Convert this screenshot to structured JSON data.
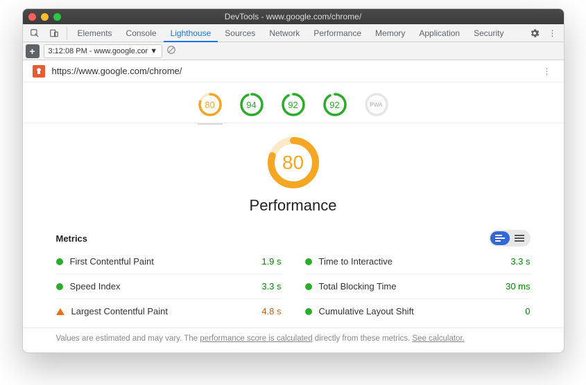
{
  "window": {
    "title": "DevTools - www.google.com/chrome/"
  },
  "tabs": [
    "Elements",
    "Console",
    "Lighthouse",
    "Sources",
    "Network",
    "Performance",
    "Memory",
    "Application",
    "Security"
  ],
  "active_tab": "Lighthouse",
  "toolbar": {
    "run_label": "3:12:08 PM - www.google.cor"
  },
  "url": "https://www.google.com/chrome/",
  "gauges": [
    {
      "score": "80",
      "color": "orange",
      "pct": 80,
      "active": true
    },
    {
      "score": "94",
      "color": "green",
      "pct": 94,
      "active": false
    },
    {
      "score": "92",
      "color": "green",
      "pct": 92,
      "active": false
    },
    {
      "score": "92",
      "color": "green",
      "pct": 92,
      "active": false
    },
    {
      "score": "PWA",
      "color": "grey",
      "pct": 0,
      "active": false
    }
  ],
  "main_gauge": {
    "score": "80",
    "title": "Performance",
    "pct": 80
  },
  "metrics_title": "Metrics",
  "metrics": [
    {
      "label": "First Contentful Paint",
      "value": "1.9 s",
      "status": "green",
      "val_color": "green"
    },
    {
      "label": "Time to Interactive",
      "value": "3.3 s",
      "status": "green",
      "val_color": "green"
    },
    {
      "label": "Speed Index",
      "value": "3.3 s",
      "status": "green",
      "val_color": "green"
    },
    {
      "label": "Total Blocking Time",
      "value": "30 ms",
      "status": "green",
      "val_color": "green"
    },
    {
      "label": "Largest Contentful Paint",
      "value": "4.8 s",
      "status": "orange",
      "val_color": "orange"
    },
    {
      "label": "Cumulative Layout Shift",
      "value": "0",
      "status": "green",
      "val_color": "green"
    }
  ],
  "footnote": {
    "pre": "Values are estimated and may vary. The ",
    "link1": "performance score is calculated",
    "mid": " directly from these metrics. ",
    "link2": "See calculator."
  }
}
